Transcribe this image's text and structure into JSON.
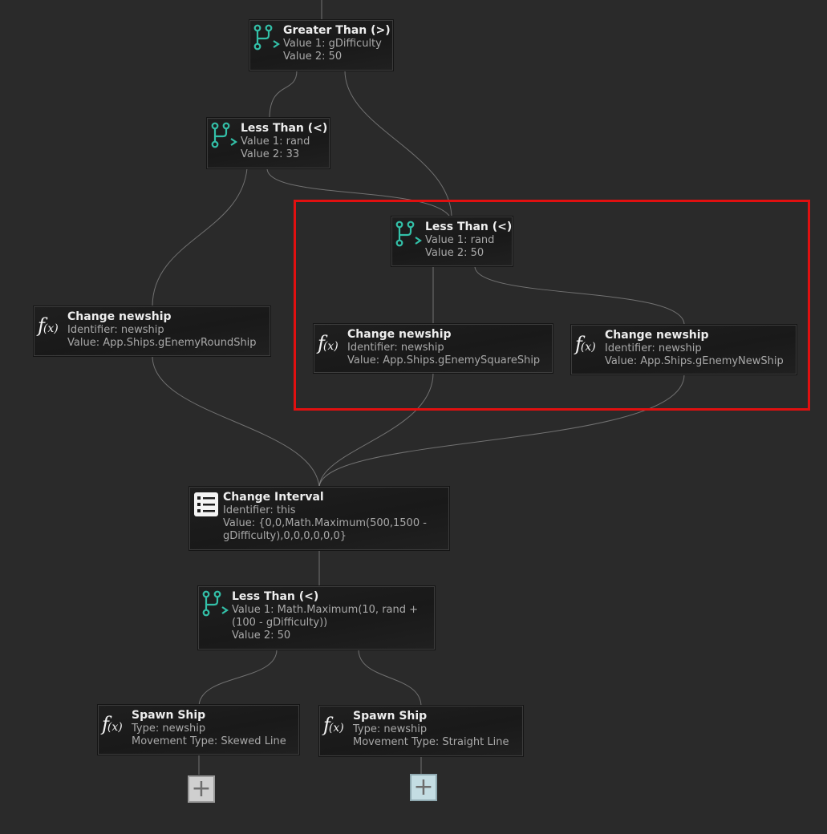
{
  "colors": {
    "canvas": "#2a2a2a",
    "node_bg": "#1c1c1c",
    "condition_icon": "#33c0a8",
    "wire": "#8a8a8a",
    "selection": "#e01010"
  },
  "nodes": {
    "greater_than": {
      "icon": "branch-icon",
      "title": "Greater Than (>)",
      "line1": "Value 1: gDifficulty",
      "line2": "Value 2: 50"
    },
    "less_than_1": {
      "icon": "branch-icon",
      "title": "Less Than (<)",
      "line1": "Value 1: rand",
      "line2": "Value 2: 33"
    },
    "less_than_2": {
      "icon": "branch-icon",
      "title": "Less Than (<)",
      "line1": "Value 1: rand",
      "line2": "Value 2: 50"
    },
    "change_newship_round": {
      "icon": "function-icon",
      "title": "Change newship",
      "line1": "Identifier: newship",
      "line2": "Value: App.Ships.gEnemyRoundShip"
    },
    "change_newship_square": {
      "icon": "function-icon",
      "title": "Change newship",
      "line1": "Identifier: newship",
      "line2": "Value: App.Ships.gEnemySquareShip"
    },
    "change_newship_new": {
      "icon": "function-icon",
      "title": "Change newship",
      "line1": "Identifier: newship",
      "line2": "Value: App.Ships.gEnemyNewShip"
    },
    "change_interval": {
      "icon": "list-icon",
      "title": "Change Interval",
      "line1": "Identifier: this",
      "line2": "Value: {0,0,Math.Maximum(500,1500 -",
      "line3": "gDifficulty),0,0,0,0,0,0}"
    },
    "less_than_3": {
      "icon": "branch-icon",
      "title": "Less Than (<)",
      "line1": "Value 1: Math.Maximum(10, rand +",
      "line2": "(100 - gDifficulty))",
      "line3": "Value 2: 50"
    },
    "spawn_ship_skewed": {
      "icon": "function-icon",
      "title": "Spawn Ship",
      "line1": "Type: newship",
      "line2": "Movement Type: Skewed Line"
    },
    "spawn_ship_straight": {
      "icon": "function-icon",
      "title": "Spawn Ship",
      "line1": "Type: newship",
      "line2": "Movement Type: Straight Line"
    }
  },
  "add_buttons": [
    {
      "icon": "plus-icon",
      "label": "+"
    },
    {
      "icon": "plus-icon",
      "label": "+"
    }
  ]
}
